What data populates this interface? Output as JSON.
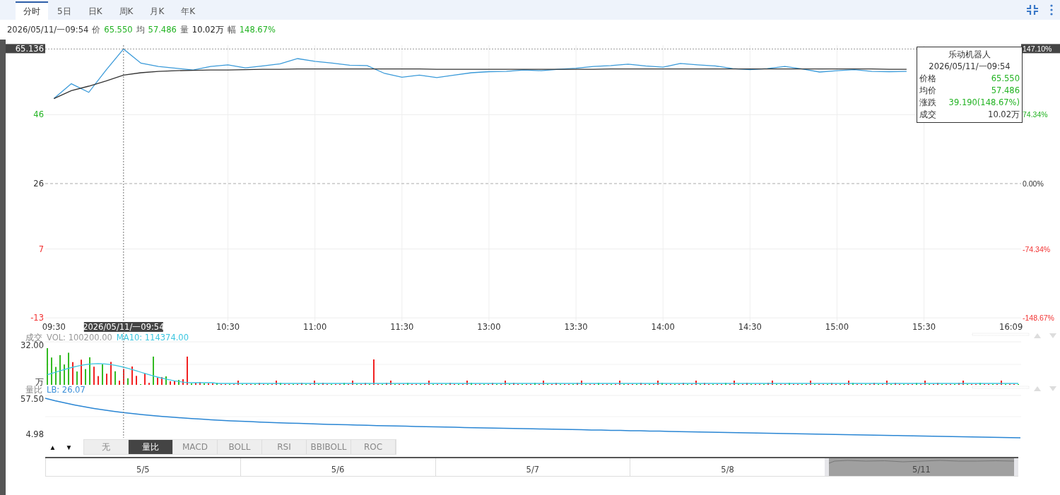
{
  "tabs": [
    {
      "label": "分时",
      "selected": true
    },
    {
      "label": "5日",
      "selected": false
    },
    {
      "label": "日K",
      "selected": false
    },
    {
      "label": "周K",
      "selected": false
    },
    {
      "label": "月K",
      "selected": false
    },
    {
      "label": "年K",
      "selected": false
    }
  ],
  "info_line": {
    "time": "2026/05/11/一09:54",
    "items": [
      {
        "label": "价",
        "value": "65.550",
        "color": "#22b322"
      },
      {
        "label": "均",
        "value": "57.486",
        "color": "#22b322"
      },
      {
        "label": "量",
        "value": "10.02万",
        "color": "#222222"
      },
      {
        "label": "幅",
        "value": "148.67%",
        "color": "#22b322"
      }
    ]
  },
  "tooltip": {
    "title": "乐动机器人",
    "time": "2026/05/11/一09:54",
    "rows": [
      {
        "label": "价格",
        "value": "65.550",
        "color": "#22b322"
      },
      {
        "label": "均价",
        "value": "57.486",
        "color": "#22b322"
      },
      {
        "label": "涨跌",
        "value": "39.190(148.67%)",
        "color": "#22b322"
      },
      {
        "label": "成交",
        "value": "10.02万",
        "color": "#333333"
      }
    ]
  },
  "price_pane": {
    "chart_data": {
      "type": "line",
      "categories": [
        "09:30",
        null,
        null,
        null,
        null,
        null,
        null,
        null,
        null,
        null,
        "10:30",
        null,
        null,
        null,
        null,
        "11:00",
        null,
        null,
        null,
        null,
        "11:30",
        null,
        null,
        null,
        null,
        "13:00",
        null,
        null,
        null,
        null,
        "13:30",
        null,
        null,
        null,
        null,
        "14:00",
        null,
        null,
        null,
        null,
        "14:30",
        null,
        null,
        null,
        null,
        "15:00",
        null,
        null,
        null,
        null,
        "15:30",
        null,
        null,
        null,
        null,
        "16:09"
      ],
      "series": [
        {
          "color": "#3a9ad9",
          "values": [
            50.7,
            55,
            52.5,
            59,
            65.1,
            61,
            60,
            59.5,
            59,
            60,
            60.5,
            59.6,
            60.2,
            60.8,
            62.3,
            61.5,
            61,
            60.4,
            60.3,
            58,
            56.9,
            57.5,
            56.8,
            57.5,
            58.2,
            58.5,
            58.6,
            59,
            58.8,
            59.2,
            59.5,
            60,
            60.3,
            60.7,
            60.2,
            59.8,
            60.9,
            60.5,
            60.2,
            59.4,
            59.1,
            59.4,
            60,
            59.3,
            58.4,
            58.8,
            59.1,
            58.6,
            58.5,
            58.6,
            null,
            null,
            null,
            null,
            null,
            null
          ]
        },
        {
          "color": "#333333",
          "values": [
            50.7,
            53,
            54.3,
            55.8,
            57.5,
            58.2,
            58.6,
            58.8,
            58.9,
            59,
            59,
            59.1,
            59.2,
            59.2,
            59.3,
            59.3,
            59.3,
            59.3,
            59.3,
            59.3,
            59.3,
            59.3,
            59.2,
            59.2,
            59.2,
            59.2,
            59.2,
            59.2,
            59.2,
            59.2,
            59.2,
            59.2,
            59.3,
            59.3,
            59.3,
            59.3,
            59.3,
            59.3,
            59.3,
            59.3,
            59.3,
            59.3,
            59.3,
            59.3,
            59.3,
            59.3,
            59.3,
            59.3,
            59.2,
            59.2,
            null,
            null,
            null,
            null,
            null,
            null
          ]
        }
      ],
      "ylim": [
        -14,
        66.2
      ],
      "yticks": [
        {
          "value": 46,
          "label": "46"
        },
        {
          "value": 26,
          "label": "26"
        },
        {
          "value": 7,
          "label": "7"
        },
        {
          "value": -13,
          "label": "-13"
        }
      ],
      "grid": true,
      "ref_lines": [
        {
          "axis": "y",
          "value": 26
        }
      ]
    },
    "percent_labels": [
      "74.34%",
      "0.00%",
      "-74.34%",
      "-148.67%"
    ],
    "crosshair": {
      "price_label": "65.136",
      "percent_label": "147.10%",
      "time_label": "2026/05/11/一09:54"
    }
  },
  "volume_pane": {
    "legend": [
      {
        "text": "成交",
        "color": "#888888"
      },
      {
        "text": "VOL: 100200.00",
        "color": "#999999"
      },
      {
        "text": "MA10: 114374.00",
        "color": "#3cc6e0"
      }
    ],
    "axis_labels": [
      "32.00",
      "万"
    ]
  },
  "ratio_pane": {
    "legend": [
      {
        "text": "量比",
        "color": "#888888"
      },
      {
        "text": "LB: 26.07",
        "color": "#3a8fd8"
      }
    ],
    "axis_labels": [
      "57.50",
      "4.98"
    ]
  },
  "indicator_arrows": [
    "▲",
    "▼"
  ],
  "indicators": [
    {
      "label": "无",
      "selected": false
    },
    {
      "label": "量比",
      "selected": true
    },
    {
      "label": "MACD",
      "selected": false
    },
    {
      "label": "BOLL",
      "selected": false
    },
    {
      "label": "RSI",
      "selected": false
    },
    {
      "label": "BBIBOLL",
      "selected": false
    },
    {
      "label": "ROC",
      "selected": false
    }
  ],
  "navigator": [
    {
      "label": "5/5",
      "selected": false
    },
    {
      "label": "5/6",
      "selected": false
    },
    {
      "label": "5/7",
      "selected": false
    },
    {
      "label": "5/8",
      "selected": false
    },
    {
      "label": "5/11",
      "selected": true
    }
  ]
}
